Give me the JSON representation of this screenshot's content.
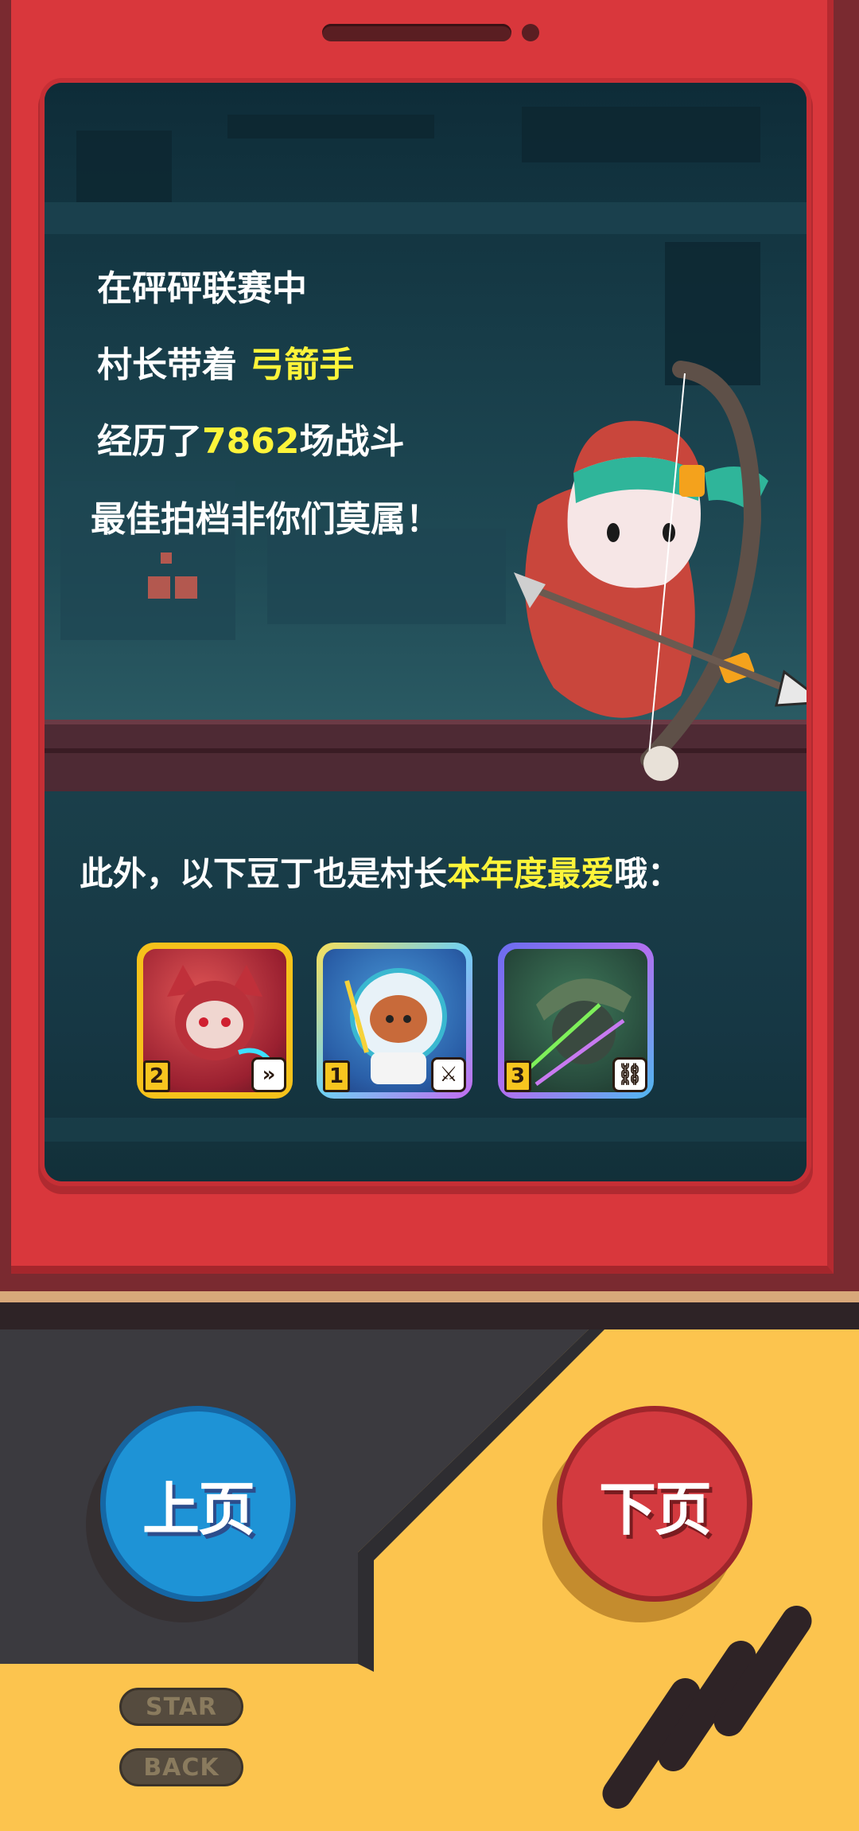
{
  "story": {
    "line1": "在砰砰联赛中",
    "line2_prefix": "村长带着 ",
    "line2_hero": "弓箭手",
    "line3_prefix": "经历了",
    "line3_count": "7862",
    "line3_suffix": "场战斗",
    "line4": "最佳拍档非你们莫属！"
  },
  "extra": {
    "prefix": "此外，以下豆丁也是村长",
    "highlight": "本年度最爱",
    "suffix": "哦："
  },
  "heroes": [
    {
      "star": "2",
      "weapon_icon": "dash-icon",
      "frame_color": "#f6c21b"
    },
    {
      "star": "1",
      "weapon_icon": "sword-icon",
      "frame_color": "#7ac8f0"
    },
    {
      "star": "3",
      "weapon_icon": "chain-icon",
      "frame_color": "#8b5cf6"
    }
  ],
  "controls": {
    "prev_label": "上页",
    "next_label": "下页",
    "start_label": "STAR",
    "back_label": "BACK"
  },
  "colors": {
    "device_red": "#d9373c",
    "panel_yellow": "#fcc44e",
    "highlight_yellow": "#fdf43a",
    "prev_blue": "#1e93d6",
    "next_red": "#d33a3f"
  }
}
